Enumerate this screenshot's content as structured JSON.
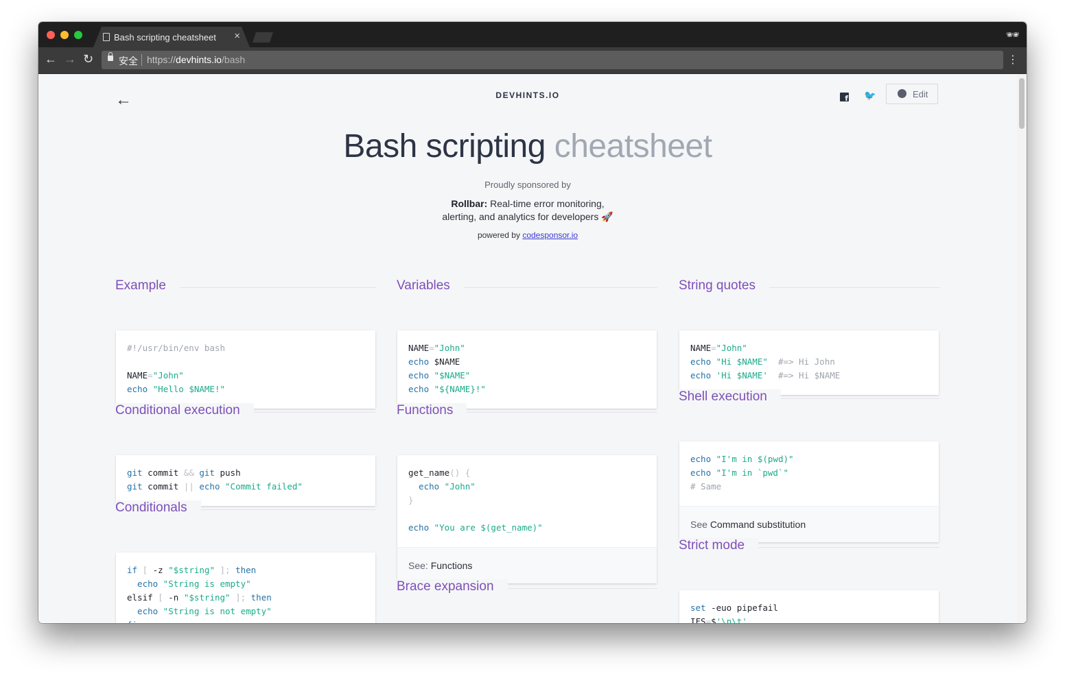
{
  "browser": {
    "tab_title": "Bash scripting cheatsheet",
    "tab_close": "×",
    "secure_label": "安全",
    "url_protocol": "https://",
    "url_host": "devhints.io",
    "url_path": "/bash",
    "back_icon": "←",
    "forward_icon": "→",
    "reload_icon": "↻",
    "menu_icon": "⋮",
    "incognito_icon": "incognito-icon"
  },
  "page": {
    "back_icon": "←",
    "brand": "DEVHINTS.IO",
    "edit_label": "Edit",
    "twitter_icon": "🐦",
    "title_main": "Bash scripting",
    "title_light": "cheatsheet",
    "sponsor_heading": "Proudly sponsored by",
    "sponsor_name": "Rollbar:",
    "sponsor_line1": "Real-time error monitoring,",
    "sponsor_line2": "alerting, and analytics for developers 🚀",
    "powered_prefix": "powered by",
    "powered_link": "codesponsor.io"
  },
  "sections": {
    "example": {
      "title": "Example",
      "l1": "#!/usr/bin/env bash",
      "l3a": "NAME",
      "l3b": "=",
      "l3c": "\"John\"",
      "l4a": "echo",
      "l4b": "\"Hello $NAME!\""
    },
    "conditional_execution": {
      "title": "Conditional execution",
      "l1a": "git",
      "l1b": " commit ",
      "l1c": "&&",
      "l1d": " git",
      "l1e": " push",
      "l2a": "git",
      "l2b": " commit ",
      "l2c": "||",
      "l2d": " echo",
      "l2e": " \"Commit failed\""
    },
    "conditionals": {
      "title": "Conditionals",
      "l1a": "if",
      "l1b": " [",
      "l1c": " -z ",
      "l1d": "\"$string\"",
      "l1e": " ];",
      "l1f": " then",
      "l2a": "  echo",
      "l2b": " \"String is empty\"",
      "l3a": "elsif",
      "l3b": " [",
      "l3c": " -n ",
      "l3d": "\"$string\"",
      "l3e": " ];",
      "l3f": " then",
      "l4a": "  echo",
      "l4b": " \"String is not empty\"",
      "l5": "fi"
    },
    "variables": {
      "title": "Variables",
      "l1a": "NAME",
      "l1b": "=",
      "l1c": "\"John\"",
      "l2a": "echo",
      "l2b": " $NAME",
      "l3a": "echo",
      "l3b": " \"$NAME\"",
      "l4a": "echo",
      "l4b": " \"${NAME}!\""
    },
    "functions": {
      "title": "Functions",
      "l1a": "get_name",
      "l1b": "()",
      "l1c": " {",
      "l2a": "  echo",
      "l2b": " \"John\"",
      "l3": "}",
      "l5a": "echo",
      "l5b": " \"You are $(get_name)\"",
      "foot_prefix": "See:",
      "foot_ref": "Functions"
    },
    "brace_expansion": {
      "title": "Brace expansion"
    },
    "string_quotes": {
      "title": "String quotes",
      "l1a": "NAME",
      "l1b": "=",
      "l1c": "\"John\"",
      "l2a": "echo",
      "l2b": " \"Hi $NAME\"",
      "l2c": "  #=> Hi John",
      "l3a": "echo",
      "l3b": " 'Hi $NAME'",
      "l3c": "  #=> Hi $NAME"
    },
    "shell_execution": {
      "title": "Shell execution",
      "l1a": "echo",
      "l1b": " \"I'm in $(pwd)\"",
      "l2a": "echo",
      "l2b": " \"I'm in `pwd`\"",
      "l3": "# Same",
      "foot_prefix": "See",
      "foot_ref": "Command substitution"
    },
    "strict_mode": {
      "title": "Strict mode",
      "l1a": "set",
      "l1b": " -euo pipefail",
      "l2a": "IFS",
      "l2b": "=",
      "l2c": "$",
      "l2d": "'\\n\\t'"
    }
  },
  "colors": {
    "section_heading": "#7d4fb8",
    "code_string": "#1aab8a",
    "code_keyword": "#2672a8",
    "code_comment": "#a0a5ad"
  }
}
